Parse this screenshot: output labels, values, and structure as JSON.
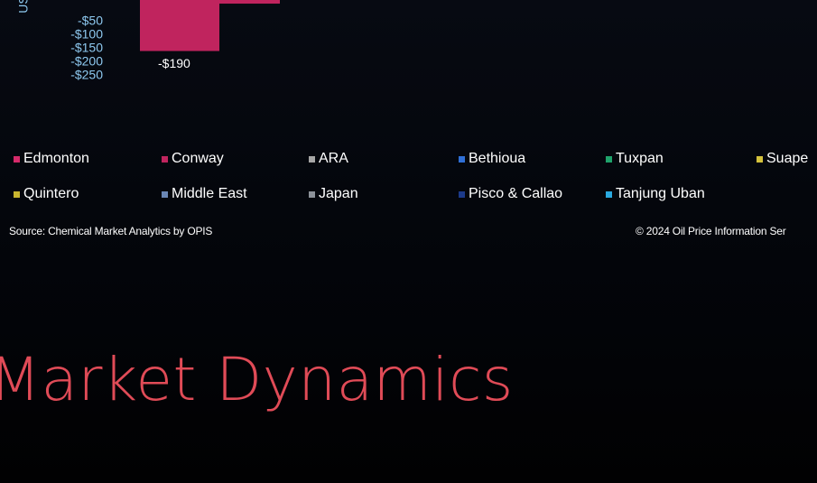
{
  "chart_data": {
    "type": "bar",
    "ylabel": "US",
    "yticks": [
      "-$50",
      "-$100",
      "-$150",
      "-$200",
      "-$250"
    ],
    "series": [
      {
        "name": "Conway",
        "color": "#c0245e",
        "value": -190,
        "value_label": "-$190"
      }
    ],
    "legend": [
      {
        "name": "Edmonton",
        "color": "#d62a6a"
      },
      {
        "name": "Conway",
        "color": "#c0245e"
      },
      {
        "name": "ARA",
        "color": "#a6a6a6"
      },
      {
        "name": "Bethioua",
        "color": "#2f6fd6"
      },
      {
        "name": "Tuxpan",
        "color": "#1fa36b"
      },
      {
        "name": "Suape",
        "color": "#d4c23c"
      },
      {
        "name": "Quintero",
        "color": "#c9b52f"
      },
      {
        "name": "Middle East",
        "color": "#6a86b4"
      },
      {
        "name": "Japan",
        "color": "#8c9199"
      },
      {
        "name": "Pisco & Callao",
        "color": "#1c3a8a"
      },
      {
        "name": "Tanjung Uban",
        "color": "#2aa9e0"
      }
    ],
    "legend_placement": "bottom",
    "grid": false
  },
  "footer": {
    "source": "Source: Chemical Market Analytics by OPIS",
    "copyright": "© 2024 Oil Price Information Ser"
  },
  "heading": "Market Dynamics"
}
